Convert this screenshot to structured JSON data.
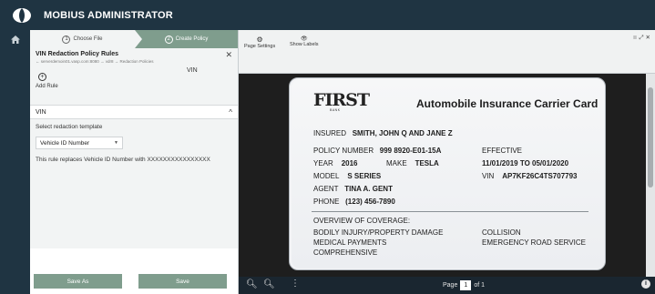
{
  "app": {
    "title": "MOBIUS ADMINISTRATOR"
  },
  "steps": [
    {
      "num": "1",
      "label": "Choose File"
    },
    {
      "num": "2",
      "label": "Create Policy"
    }
  ],
  "rules_panel": {
    "title": "VIN Redaction Policy Rules",
    "path": "← serverdemoin01.vasp.com:8080 → vdr8 → Redaction Policies",
    "header_value": "VIN",
    "add_rule_label": "Add Rule"
  },
  "rule": {
    "name": "VIN",
    "select_label": "Select redaction template",
    "selected_template": "Vehicle ID Number",
    "description": "This rule replaces Vehicle ID Number with XXXXXXXXXXXXXXXX"
  },
  "buttons": {
    "save_as": "Save As",
    "save": "Save"
  },
  "viewer": {
    "page_settings_label": "Page Settings",
    "show_labels_label": "Show Labels",
    "page_label": "Page",
    "current_page": "1",
    "of_label": "of",
    "total_pages": "1"
  },
  "card": {
    "bank_name": "FIRST",
    "bank_sub": "BANK",
    "title": "Automobile Insurance Carrier Card",
    "insured_label": "INSURED",
    "insured_value": "SMITH, JOHN Q AND JANE Z",
    "policy_label": "POLICY NUMBER",
    "policy_value": "999 8920-E01-15A",
    "effective_label": "EFFECTIVE",
    "year_label": "YEAR",
    "year_value": "2016",
    "make_label": "MAKE",
    "make_value": "TESLA",
    "effective_value": "11/01/2019 TO 05/01/2020",
    "model_label": "MODEL",
    "model_value": "S SERIES",
    "vin_label": "VIN",
    "vin_value": "AP7KF26C4TS707793",
    "agent_label": "AGENT",
    "agent_value": "TINA A. GENT",
    "phone_label": "PHONE",
    "phone_value": "(123) 456-7890",
    "overview_label": "OVERVIEW OF COVERAGE:",
    "coverage_left": [
      "BODILY INJURY/PROPERTY DAMAGE",
      "MEDICAL PAYMENTS",
      "COMPREHENSIVE"
    ],
    "coverage_right": [
      "COLLISION",
      "EMERGENCY ROAD SERVICE"
    ]
  },
  "colors": {
    "topbar": "#1f3442",
    "accent_green": "#7f9d8d",
    "panel_bg": "#f2f4f4"
  }
}
